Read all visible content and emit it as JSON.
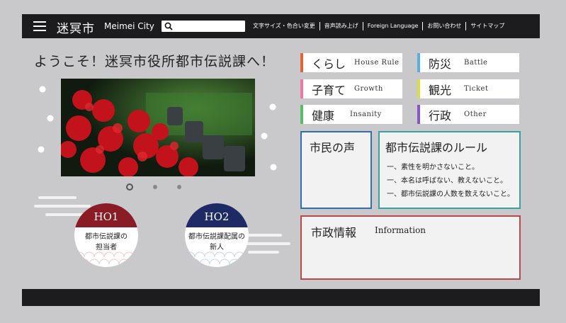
{
  "header": {
    "title": "迷冥市",
    "subtitle": "Meimei City",
    "search_placeholder": "",
    "nav": [
      "文字サイズ・色合い変更",
      "音声読み上げ",
      "Foreign Language",
      "お問い合わせ",
      "サイトマップ"
    ]
  },
  "welcome": "ようこそ！迷冥市役所都市伝説課へ！",
  "carousel": {
    "slides": 3,
    "active_index": 0
  },
  "ho": [
    {
      "tag": "HO1",
      "line1": "都市伝説課の",
      "line2": "担当者",
      "color": "#8a1c26"
    },
    {
      "tag": "HO2",
      "line1": "都市伝説課配属の",
      "line2": "新人",
      "color": "#1e2a66"
    }
  ],
  "categories": [
    {
      "jp": "くらし",
      "en": "House Rule",
      "color": "#e0663a"
    },
    {
      "jp": "防災",
      "en": "Battle",
      "color": "#5aaee0"
    },
    {
      "jp": "子育て",
      "en": "Growth",
      "color": "#ec7aa0"
    },
    {
      "jp": "観光",
      "en": "Ticket",
      "color": "#d9dd48"
    },
    {
      "jp": "健康",
      "en": "Insanity",
      "color": "#5cbb6a"
    },
    {
      "jp": "行政",
      "en": "Other",
      "color": "#8a55c8"
    }
  ],
  "voice": {
    "title": "市民の声",
    "color": "#2f6fb8"
  },
  "rules": {
    "title": "都市伝説課のルール",
    "color": "#3aa0a0",
    "items": [
      "一、素性を明かさないこと。",
      "一、本名は呼ばない、教えないこと。",
      "一、都市伝説課の人数を数えないこと。"
    ]
  },
  "info": {
    "title": "市政情報",
    "subtitle": "Information",
    "color": "#b84a4a"
  }
}
